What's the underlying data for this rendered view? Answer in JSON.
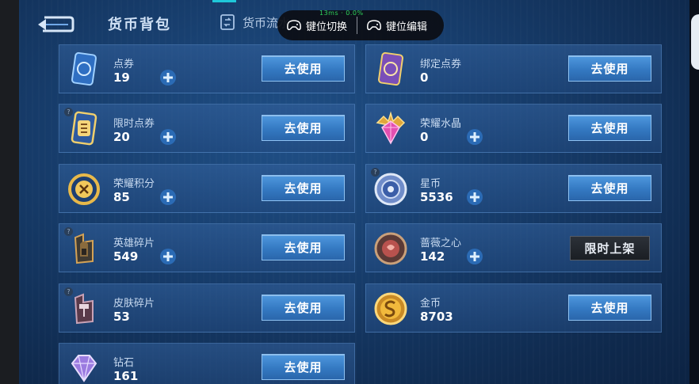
{
  "header": {
    "title": "货币背包",
    "tab_flow": "货币流水"
  },
  "overlay": {
    "stat": "13ms · 0.0%",
    "switch_label": "键位切换",
    "edit_label": "键位编辑"
  },
  "left_column": [
    {
      "name": "点券",
      "value": "19",
      "button": "去使用",
      "icon": "voucher-card-icon"
    },
    {
      "name": "限时点券",
      "value": "20",
      "button": "去使用",
      "icon": "limited-voucher-icon"
    },
    {
      "name": "荣耀积分",
      "value": "85",
      "button": "去使用",
      "icon": "honor-points-icon"
    },
    {
      "name": "英雄碎片",
      "value": "549",
      "button": "去使用",
      "icon": "hero-fragment-icon"
    },
    {
      "name": "皮肤碎片",
      "value": "53",
      "button": "去使用",
      "icon": "skin-fragment-icon"
    },
    {
      "name": "钻石",
      "value": "161",
      "button": "去使用",
      "icon": "diamond-icon"
    }
  ],
  "right_column": [
    {
      "name": "绑定点券",
      "value": "0",
      "button": "去使用",
      "icon": "bound-voucher-icon"
    },
    {
      "name": "荣耀水晶",
      "value": "0",
      "button": "去使用",
      "icon": "honor-crystal-icon"
    },
    {
      "name": "星币",
      "value": "5536",
      "button": "去使用",
      "icon": "star-coin-icon"
    },
    {
      "name": "蔷薇之心",
      "value": "142",
      "button": "限时上架",
      "icon": "rose-heart-icon"
    },
    {
      "name": "金币",
      "value": "8703",
      "button": "去使用",
      "icon": "gold-coin-icon"
    }
  ],
  "colors": {
    "background": "#163b69",
    "button": "#3479c2",
    "accent": "#1fc7d9"
  }
}
